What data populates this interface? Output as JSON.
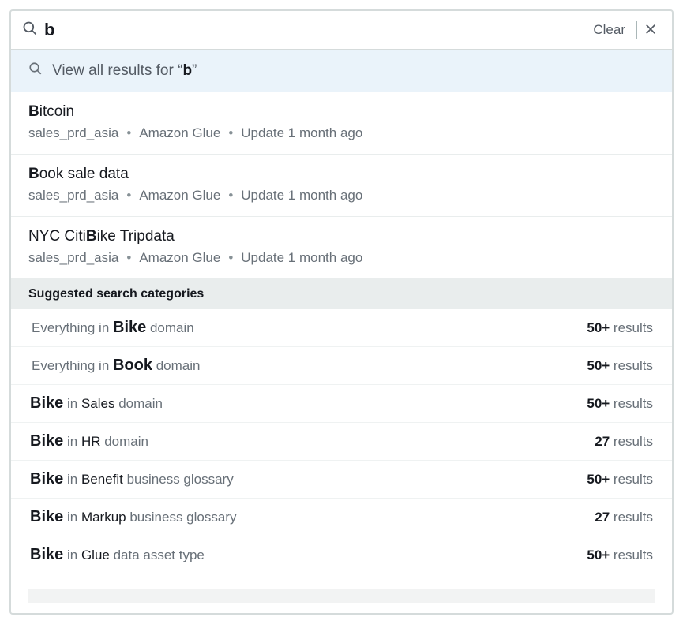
{
  "search": {
    "value": "b",
    "clear_label": "Clear"
  },
  "view_all": {
    "prefix": "View all results for ",
    "open_quote": "“",
    "query": "b",
    "close_quote": "”"
  },
  "results": [
    {
      "title_bold": "B",
      "title_rest": "itcoin",
      "source": "sales_prd_asia",
      "service": "Amazon Glue",
      "updated": "Update 1 month ago"
    },
    {
      "title_bold": "B",
      "title_rest": "ook sale data",
      "source": "sales_prd_asia",
      "service": "Amazon Glue",
      "updated": "Update 1 month ago"
    },
    {
      "title_pre": "NYC Citi",
      "title_bold": "B",
      "title_rest": "ike Tripdata",
      "source": "sales_prd_asia",
      "service": "Amazon Glue",
      "updated": "Update 1 month ago"
    }
  ],
  "suggested_header": "Suggested search categories",
  "categories": [
    {
      "prefix": "Everything in ",
      "keyword": "Bike",
      "suffix": " domain",
      "count": "50+",
      "count_label": " results",
      "group": 1
    },
    {
      "prefix": "Everything in ",
      "keyword": "Book",
      "suffix": " domain",
      "count": "50+",
      "count_label": " results",
      "group": 1
    },
    {
      "keyword": "Bike",
      "mid": " in ",
      "scope": "Sales",
      "suffix": " domain",
      "count": "50+",
      "count_label": " results",
      "group": 2
    },
    {
      "keyword": "Bike",
      "mid": " in ",
      "scope": "HR",
      "suffix": " domain",
      "count": "27",
      "count_label": " results",
      "group": 2
    },
    {
      "keyword": "Bike",
      "mid": " in ",
      "scope": "Benefit",
      "suffix": " business glossary",
      "count": "50+",
      "count_label": " results",
      "group": 2
    },
    {
      "keyword": "Bike",
      "mid": " in ",
      "scope": "Markup",
      "suffix": " business glossary",
      "count": "27",
      "count_label": " results",
      "group": 2
    },
    {
      "keyword": "Bike",
      "mid": " in ",
      "scope": "Glue",
      "suffix": " data asset type",
      "count": "50+",
      "count_label": " results",
      "group": 2
    }
  ]
}
